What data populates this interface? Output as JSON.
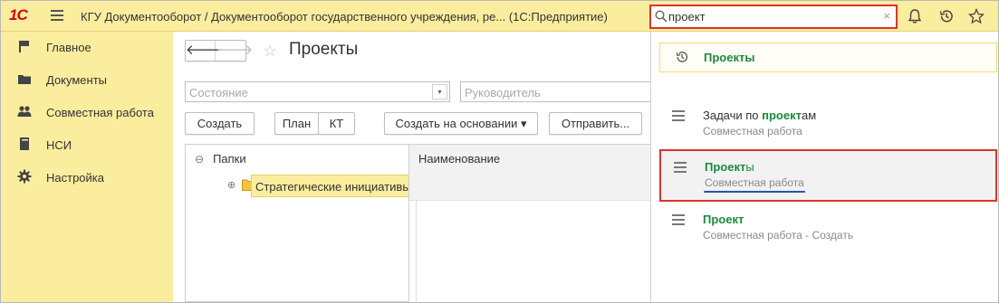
{
  "header": {
    "logo_text": "1С",
    "title": "КГУ Документооборот / Документооборот государственного учреждения, ре...  (1С:Предприятие)",
    "search_value": "проект",
    "clear_icon": "×"
  },
  "sidebar": {
    "items": [
      {
        "label": "Главное",
        "icon": "flag-icon"
      },
      {
        "label": "Документы",
        "icon": "folder-icon"
      },
      {
        "label": "Совместная работа",
        "icon": "people-icon"
      },
      {
        "label": "НСИ",
        "icon": "book-icon"
      },
      {
        "label": "Настройка",
        "icon": "gear-icon"
      }
    ]
  },
  "main": {
    "nav_back": "🡐",
    "nav_forward": "🡒",
    "star": "☆",
    "title": "Проекты",
    "filters": {
      "state_placeholder": "Состояние",
      "dropdown_glyph": "▾",
      "manager_placeholder": "Руководитель"
    },
    "toolbar": {
      "create": "Создать",
      "plan": "План",
      "kt": "КТ",
      "create_based_on": "Создать на основании ▾",
      "send": "Отправить..."
    },
    "tree": {
      "root_toggle": "⊖",
      "root": "Папки",
      "child_toggle": "⊕",
      "child": "Стратегические инициативы"
    },
    "list": {
      "column_name": "Наименование"
    }
  },
  "popup": {
    "history": {
      "match": "Проекты"
    },
    "results": [
      {
        "title_match": "Задачи по ",
        "title_hl": "проект",
        "title_rest": "ам",
        "subtitle": "Совместная работа"
      },
      {
        "title_match": "",
        "title_hl": "Проект",
        "title_rest": "ы",
        "subtitle": "Совместная работа"
      },
      {
        "title_match": "",
        "title_hl": "Проект",
        "title_rest": "",
        "subtitle": "Совместная работа - Создать"
      }
    ]
  },
  "colors": {
    "topbar": "#fbed9e",
    "highlight_border": "#d9342b",
    "match_text": "#1a8b3b",
    "logo": "#d0021b"
  }
}
